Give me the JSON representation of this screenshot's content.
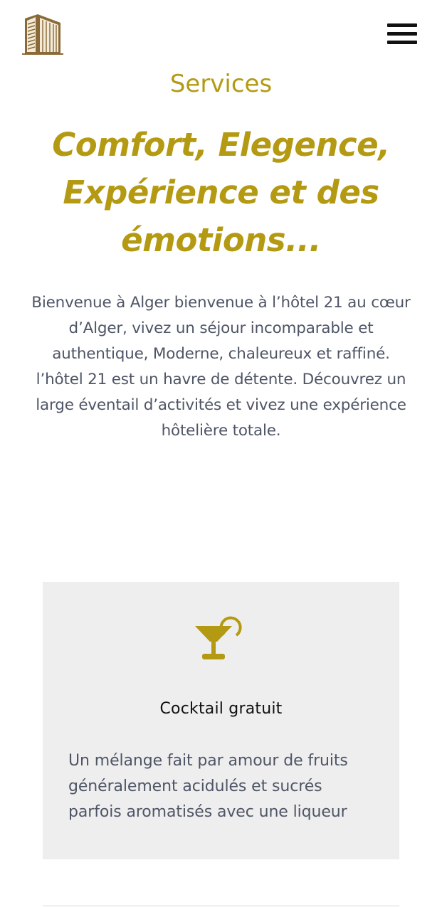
{
  "header": {
    "logo_icon": "hotel-building-logo",
    "menu_icon": "hamburger-menu-icon"
  },
  "services": {
    "label": "Services",
    "headline_lines": [
      "Comfort, Elegence,",
      "Expérience et des",
      "émotions..."
    ],
    "intro_lines": [
      "Bienvenue à Alger bienvenue à l’hôtel 21 au cœur",
      "d’Alger, vivez un séjour incomparable et",
      "authentique, Moderne, chaleureux et raffiné.",
      "l’hôtel 21 est un havre de détente. Découvrez un",
      "large éventail d’activités et vivez une expérience",
      "hôtelière totale."
    ]
  },
  "card": {
    "icon": "cocktail-icon",
    "title": "Cocktail gratuit",
    "desc_lines": [
      "Un mélange fait par amour de fruits",
      "généralement acidulés et sucrés",
      "parfois aromatisés avec une liqueur"
    ]
  },
  "colors": {
    "accent": "#b49a12",
    "logo_brown": "#8a6a38",
    "text": "#4e5566",
    "card_bg": "#eeeeee"
  }
}
